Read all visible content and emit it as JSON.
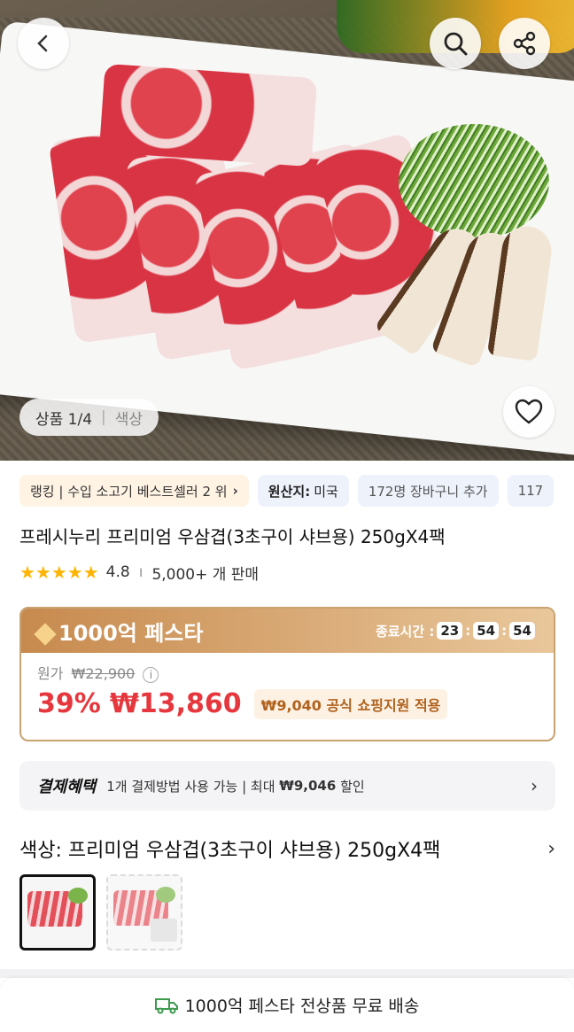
{
  "hero": {
    "counter_label": "상품 1/4",
    "counter_tab": "색상"
  },
  "icons": {
    "back": "chevron-left-icon",
    "search": "search-icon",
    "share": "share-icon",
    "heart": "heart-icon"
  },
  "chips": {
    "ranking": "랭킹 | 수입 소고기 베스트셀러 2 위",
    "origin_label": "원산지:",
    "origin_value": "미국",
    "cart": "172명 장바구니 추가",
    "overflow": "117"
  },
  "product": {
    "title": "프레시누리 프리미엄 우삼겹(3초구이 샤브용) 250gX4팩",
    "rating": "4.8",
    "rating_stars": 5,
    "sales": "5,000+ 개 판매"
  },
  "promo": {
    "brand": "1000억 페스타",
    "end_label": "종료시간 :",
    "hours": "23",
    "minutes": "54",
    "seconds": "54",
    "orig_label": "원가",
    "orig_price": "₩22,900",
    "discount": "39%",
    "price": "₩13,860",
    "support": "₩9,040 공식 쇼핑지원 적용"
  },
  "payment": {
    "label": "결제혜택",
    "text_a": "1개 결제방법 사용 가능 | 최대",
    "amount": "₩9,046",
    "text_b": "할인"
  },
  "option": {
    "label": "색상: 프리미엄 우삼겹(3초구이 샤브용) 250gX4팩"
  },
  "shipping": {
    "text": "1000억 페스타 전상품 무료 배송"
  },
  "colors": {
    "price_red": "#e5373d",
    "promo_gold": "#c9a271",
    "star": "#ffb400"
  }
}
